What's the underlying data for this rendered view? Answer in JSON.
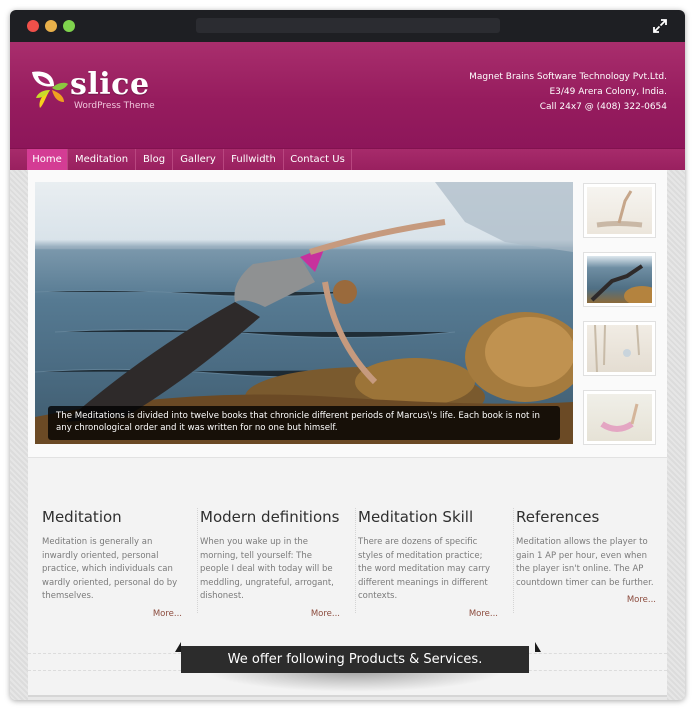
{
  "window": {
    "controls": [
      "close",
      "minimize",
      "zoom"
    ],
    "expand_icon": "expand-arrows-icon"
  },
  "header": {
    "logo_word": "slice",
    "logo_tagline": "WordPress Theme",
    "logo_icon": "butterfly-leaf-logo-icon",
    "contact": {
      "company": "Magnet Brains Software Technology Pvt.Ltd.",
      "address": "E3/49 Arera Colony, India.",
      "phone": "Call 24x7 @ (408) 322-0654"
    },
    "brand_color": "#961c5e"
  },
  "nav": {
    "items": [
      {
        "label": "Home",
        "active": true
      },
      {
        "label": "Meditation",
        "active": false
      },
      {
        "label": "Blog",
        "active": false
      },
      {
        "label": "Gallery",
        "active": false
      },
      {
        "label": "Fullwidth",
        "active": false
      },
      {
        "label": "Contact Us",
        "active": false
      }
    ],
    "active_color": "#d43c94"
  },
  "slider": {
    "caption": "The Meditations is divided into twelve books that chronicle different periods of Marcus\\'s life. Each book is not in any chronological order and it was written for no one but himself.",
    "thumbnails": [
      {
        "name": "yoga-seated-stretch",
        "active": false
      },
      {
        "name": "yoga-backbend-rocks",
        "active": true
      },
      {
        "name": "yoga-forest-meditation",
        "active": false
      },
      {
        "name": "yoga-bow-pose",
        "active": false
      }
    ]
  },
  "columns": [
    {
      "title": "Meditation",
      "text": "Meditation is generally an inwardly oriented, personal practice, which individuals can wardly oriented, personal do by themselves.",
      "more": "More..."
    },
    {
      "title": "Modern definitions",
      "text": "When you wake up in the morning, tell yourself: The people I deal with today will be meddling, ungrateful, arrogant, dishonest.",
      "more": "More..."
    },
    {
      "title": "Meditation Skill",
      "text": "There are dozens of specific styles of meditation practice; the word meditation may carry different meanings in different contexts.",
      "more": "More..."
    },
    {
      "title": "References",
      "text": "Meditation allows the player to gain 1 AP per hour, even when the player isn't online. The AP countdown timer can be further.",
      "more": "More..."
    }
  ],
  "ribbon": {
    "text": "We offer following Products & Services."
  }
}
